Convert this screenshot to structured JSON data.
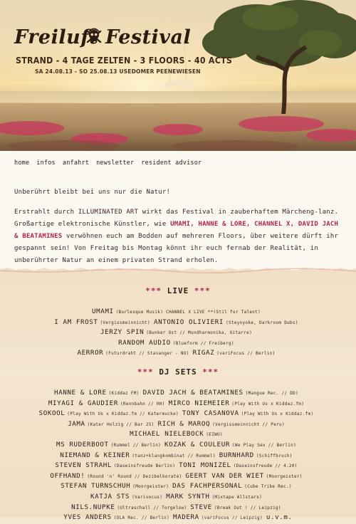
{
  "header": {
    "logo_word1": "Freiluft",
    "logo_word2": "Festival",
    "tagline": "STRAND - 4 TAGE ZELTEN - 3 FLOORS - 40 ACTS",
    "dates": "SA 24.08.13 - SO 25.08.13 USEDOMER PEENEWIESEN"
  },
  "nav": [
    "home",
    "infos",
    "anfahrt",
    "newsletter",
    "resident advisor"
  ],
  "intro": {
    "line1": "Unberührt bleibt bei uns nur die Natur!",
    "p2_a": "Erstrahlt durch ILLUMINATED ART wirkt das Festival in zauberhaftem Märcheng-lanz. Großartige elektronische Künstler, wie ",
    "p2_highlight": "UMAMI, HANNE & LORE, CHANNEL X, DAVID JACH & BEATAMINES",
    "p2_b": " verwöhnen euch am Bodden auf mehreren Floors, über weitere dürft ihr gespannt sein! Von Freitag bis Montag könnt ihr euch fernab der Realität, in unberührter Natur an einem privaten Strand erholen."
  },
  "live": {
    "heading": "LIVE",
    "stars": "***",
    "rows": [
      [
        "UMAMI",
        "(Burlesque Musik) CHANNEL X LIVE **(Stil for Talent)"
      ],
      [
        "I AM FROST",
        "(Vergissmeinnicht)",
        "ANTONIO OLIVIERI",
        "(Steyoyoke, Darkroom Dubs)"
      ],
      [
        "JERZY SPIN",
        "(Bunker Ost // Mundharmonika, Gitarre)"
      ],
      [
        "RANDOM AUDIO",
        "(Blueform // Freiberg)"
      ],
      [
        "AERROR",
        "(Futurdraht // Stavanger - NO)",
        "RIGAZ",
        "(variFocus // Berlin)"
      ]
    ]
  },
  "djsets": {
    "heading": "DJ SETS",
    "stars": "***",
    "rows": [
      [
        "HANNE & LORE",
        "(Kiddaz FM)",
        "DAVID JACH & BEATAMINES",
        "(Mangue Rec. // DD)"
      ],
      [
        "MIYAGI & GAUDIER",
        "(Rennbahn // HH)",
        "MIRCO NIEMEIER",
        "(Play With Us x Kiddaz.fm)"
      ],
      [
        "SOKOOL",
        "(Play With Us x Kiddaz.fm // Katermucke)",
        "TONY CASANOVA",
        "(Play With Us x Kiddaz.fm)"
      ],
      [
        "JAMA",
        "(Kater Holzig // Bar 25)",
        "RICH & MAROQ",
        "(Vergissmeinnicht // Peru)"
      ],
      [
        "MICHAEL NIELEBOCK",
        "(EIWO)"
      ],
      [
        "MS RUDERBOOT",
        "(Rummel // Berlin)",
        "KOZAK & COULEUR",
        "(We Play Sex // Berlin)"
      ],
      [
        "NIEMAND & KEINER",
        "(tanz+klangkombinat // Rummel)",
        "BURNHARD",
        "(Schiffbruch)"
      ],
      [
        "STEVEN STRAHL",
        "(Daseinsfreude Berlin)",
        "TONI MONIZEL",
        "(Daseinsfreude // 4.20)"
      ],
      [
        "OFFHAND!",
        "(Round 'n' Round // Dezibelkoraté)",
        "GEERT VAN DER WIET",
        "(Moorgeister)"
      ],
      [
        "STEFAN TURNSCHUH",
        "(Moorgeister)",
        "DAS FACHPERSONAL",
        "(Cube Tribe Rec.)"
      ],
      [
        "KATJA STS",
        "(Varivocus)",
        "MARK SYNTH",
        "(Mixtape Allstars)"
      ],
      [
        "NILS.NUPKE",
        "(Ultraschall // Torgelow)",
        "STEVE",
        "(Break Out ! // Leipzig)"
      ],
      [
        "YVES ANDERS",
        "(OLA Rec. // Berlin)",
        "MADERA",
        "(variFocus // Leipzig)",
        "u.v.m."
      ]
    ]
  },
  "colors": {
    "accent_red": "#b1264a",
    "paper": "#fbf7f1",
    "parchment": "#f1dfc6",
    "ink": "#2a1d14"
  },
  "icons": [
    "skull-crossbones-icon"
  ]
}
